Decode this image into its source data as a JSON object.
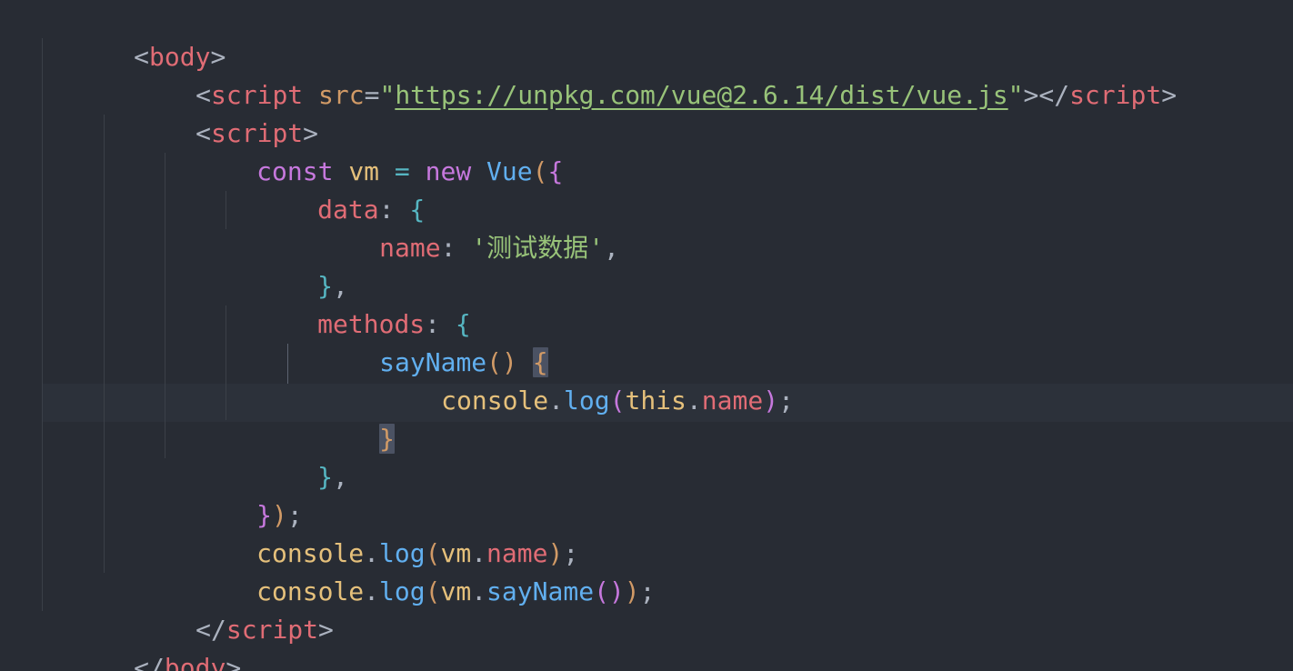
{
  "editor": {
    "theme_colors": {
      "background": "#282c34",
      "current_line": "#2c313a",
      "tag": "#e06c75",
      "attribute": "#d19a66",
      "string": "#98c379",
      "keyword": "#c678dd",
      "variable": "#e5c07b",
      "function": "#61afef",
      "operator": "#56b6c2"
    },
    "lines": [
      {
        "t1": "<",
        "t2": "body",
        "t3": ">"
      },
      {
        "t1": "<",
        "t2": "script",
        "t3": " ",
        "t4": "src",
        "t5": "=",
        "t6": "\"",
        "t7": "https://unpkg.com/vue@2.6.14/dist/vue.js",
        "t8": "\"",
        "t9": "></",
        "t10": "script",
        "t11": ">"
      },
      {
        "t1": "<",
        "t2": "script",
        "t3": ">"
      },
      {
        "t1": "const",
        "t2": " ",
        "t3": "vm",
        "t4": " ",
        "t5": "=",
        "t6": " ",
        "t7": "new",
        "t8": " ",
        "t9": "Vue",
        "t10": "(",
        "t11": "{"
      },
      {
        "t1": "data",
        "t2": ": ",
        "t3": "{"
      },
      {
        "t1": "name",
        "t2": ": ",
        "t3": "'",
        "t4": "测试数据",
        "t5": "'",
        "t6": ","
      },
      {
        "t1": "}",
        "t2": ","
      },
      {
        "t1": "methods",
        "t2": ": ",
        "t3": "{"
      },
      {
        "t1": "sayName",
        "t2": "()",
        "t3": " ",
        "t4": "{"
      },
      {
        "t1": "console",
        "t2": ".",
        "t3": "log",
        "t4": "(",
        "t5": "this",
        "t6": ".",
        "t7": "name",
        "t8": ")",
        "t9": ";"
      },
      {
        "t1": "}"
      },
      {
        "t1": "}",
        "t2": ","
      },
      {
        "t1": "}",
        "t2": ")",
        "t3": ";"
      },
      {
        "t1": "console",
        "t2": ".",
        "t3": "log",
        "t4": "(",
        "t5": "vm",
        "t6": ".",
        "t7": "name",
        "t8": ")",
        "t9": ";"
      },
      {
        "t1": "console",
        "t2": ".",
        "t3": "log",
        "t4": "(",
        "t5": "vm",
        "t6": ".",
        "t7": "sayName",
        "t8": "()",
        "t9": ")",
        "t10": ";"
      },
      {
        "t1": "</",
        "t2": "script",
        "t3": ">"
      },
      {
        "t1": "</",
        "t2": "body",
        "t3": ">"
      }
    ]
  }
}
